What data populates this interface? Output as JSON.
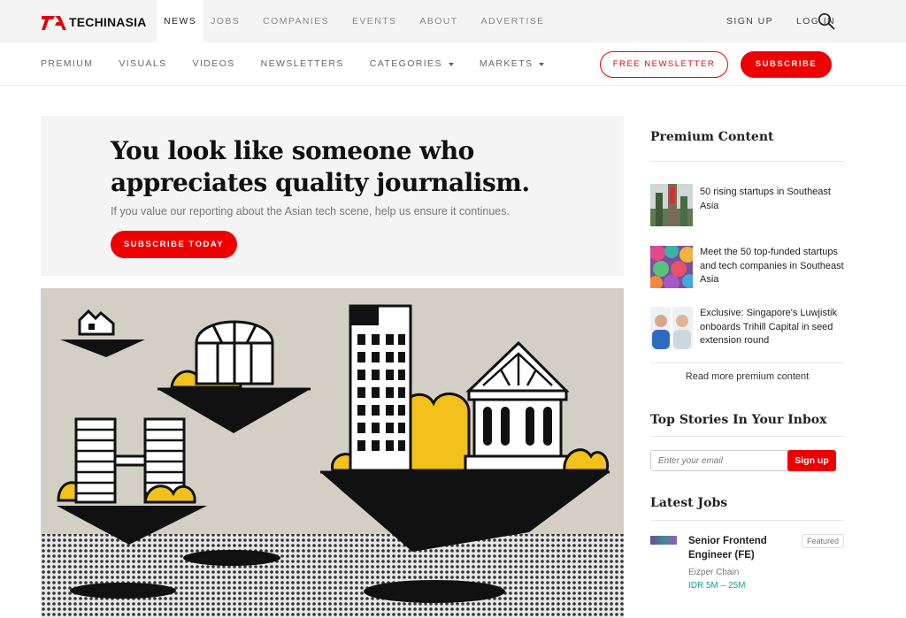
{
  "brand": {
    "logo_text": "TECHINASIA",
    "accent": "#e60000"
  },
  "topnav": {
    "items": [
      "NEWS",
      "JOBS",
      "COMPANIES",
      "EVENTS",
      "ABOUT",
      "ADVERTISE"
    ],
    "active": "NEWS",
    "signup": "SIGN UP",
    "login": "LOG IN"
  },
  "subnav": {
    "items": [
      "PREMIUM",
      "VISUALS",
      "VIDEOS",
      "NEWSLETTERS",
      "CATEGORIES",
      "MARKETS"
    ],
    "free_newsletter": "FREE NEWSLETTER",
    "subscribe": "SUBSCRIBE"
  },
  "promo": {
    "headline": "You look like someone who appreciates quality journalism.",
    "body": "If you value our reporting about the Asian tech scene, help us ensure it continues.",
    "cta": "SUBSCRIBE TODAY"
  },
  "sidebar": {
    "premium_title": "Premium Content",
    "premium_items": [
      {
        "title": "50 rising startups in Southeast Asia"
      },
      {
        "title": "Meet the 50 top-funded startups and tech companies in Southeast Asia"
      },
      {
        "title": "Exclusive: Singapore's Luwjistik onboards Trihill Capital in seed extension round"
      }
    ],
    "read_more": "Read more premium content",
    "inbox_title": "Top Stories In Your Inbox",
    "email_placeholder": "Enter your email",
    "signup": "Sign up",
    "jobs_title": "Latest Jobs",
    "jobs": [
      {
        "title": "Senior Frontend Engineer (FE)",
        "company": "Eizper Chain",
        "salary": "IDR 5M – 25M",
        "badge": "Featured"
      }
    ]
  }
}
